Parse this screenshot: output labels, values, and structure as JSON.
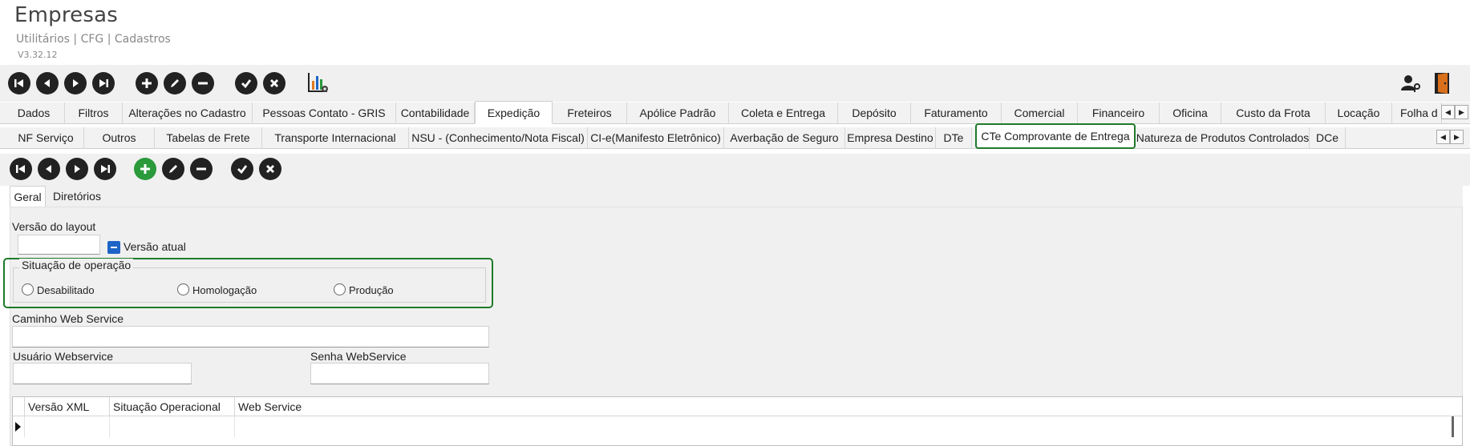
{
  "header": {
    "title": "Empresas",
    "breadcrumb": "Utilitários | CFG | Cadastros",
    "version": "V3.32.12"
  },
  "toolbar_main": {
    "buttons": [
      "first-icon",
      "previous-icon",
      "next-icon",
      "last-icon",
      "add-icon",
      "edit-icon",
      "remove-icon",
      "confirm-icon",
      "cancel-icon",
      "report-chart-icon"
    ],
    "right_icons": [
      "user-key-icon",
      "exit-door-icon"
    ]
  },
  "tabs_main": [
    {
      "label": "Dados"
    },
    {
      "label": "Filtros"
    },
    {
      "label": "Alterações no Cadastro"
    },
    {
      "label": "Pessoas Contato - GRIS"
    },
    {
      "label": "Contabilidade"
    },
    {
      "label": "Expedição"
    },
    {
      "label": "Freteiros"
    },
    {
      "label": "Apólice Padrão"
    },
    {
      "label": "Coleta e Entrega"
    },
    {
      "label": "Depósito"
    },
    {
      "label": "Faturamento"
    },
    {
      "label": "Comercial"
    },
    {
      "label": "Financeiro"
    },
    {
      "label": "Oficina"
    },
    {
      "label": "Custo da Frota"
    },
    {
      "label": "Locação"
    },
    {
      "label": "Folha d"
    }
  ],
  "tabs_sub": [
    {
      "label": "NF Serviço"
    },
    {
      "label": "Outros"
    },
    {
      "label": "Tabelas de Frete"
    },
    {
      "label": "Transporte Internacional"
    },
    {
      "label": "NSU - (Conhecimento/Nota Fiscal)"
    },
    {
      "label": "CI-e(Manifesto Eletrônico)"
    },
    {
      "label": "Averbação de Seguro"
    },
    {
      "label": "Empresa Destino"
    },
    {
      "label": "DTe"
    },
    {
      "label": "CTe Comprovante de Entrega"
    },
    {
      "label": "Natureza de Produtos Controlados"
    },
    {
      "label": "DCe"
    }
  ],
  "inner_tabs": [
    {
      "label": "Geral"
    },
    {
      "label": "Diretórios"
    }
  ],
  "form": {
    "layout_version_label": "Versão do layout",
    "layout_version_value": "",
    "current_version_label": "Versão atual",
    "operation_group_label": "Situação de operação",
    "radio_options": [
      "Desabilitado",
      "Homologação",
      "Produção"
    ],
    "ws_path_label": "Caminho Web Service",
    "ws_path_value": "",
    "ws_user_label": "Usuário Webservice",
    "ws_user_value": "",
    "ws_password_label": "Senha WebService",
    "ws_password_value": ""
  },
  "grid": {
    "columns": [
      "Versão XML",
      "Situação Operacional",
      "Web Service"
    ]
  },
  "colors": {
    "highlight_green": "#1f7a2a",
    "add_green": "#2a9a3a",
    "checkbox_blue": "#1e64c8",
    "chart_icon": [
      "#e07a1f",
      "#1e64c8",
      "#2a9a3a"
    ]
  }
}
